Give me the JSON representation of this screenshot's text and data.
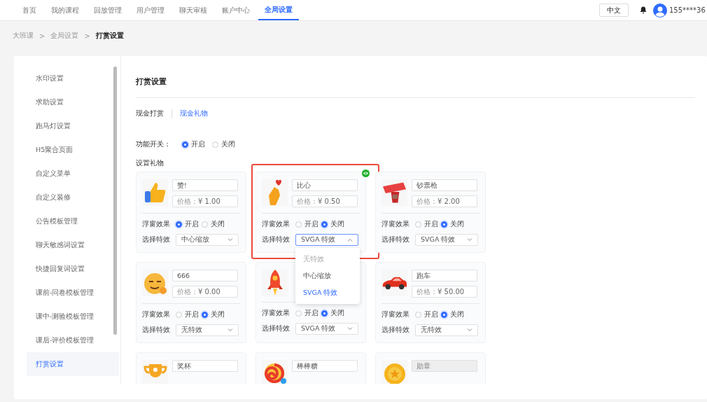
{
  "nav": {
    "tabs": [
      {
        "label": "首页",
        "selected": false
      },
      {
        "label": "我的课程",
        "selected": false
      },
      {
        "label": "回放管理",
        "selected": false
      },
      {
        "label": "用户管理",
        "selected": false
      },
      {
        "label": "聊天审核",
        "selected": false
      },
      {
        "label": "账户中心",
        "selected": false
      },
      {
        "label": "全局设置",
        "selected": true
      }
    ],
    "language": "中文",
    "user": "155****36"
  },
  "breadcrumb": [
    "大班课",
    "全局设置",
    "打赏设置"
  ],
  "breadcrumb_separator": ">",
  "sidebar": {
    "items": [
      {
        "label": "水印设置",
        "selected": false
      },
      {
        "label": "求助设置",
        "selected": false
      },
      {
        "label": "跑马灯设置",
        "selected": false
      },
      {
        "label": "H5聚合页面",
        "selected": false
      },
      {
        "label": "自定义菜单",
        "selected": false
      },
      {
        "label": "自定义装修",
        "selected": false
      },
      {
        "label": "公告模板管理",
        "selected": false
      },
      {
        "label": "聊天敏感词设置",
        "selected": false
      },
      {
        "label": "快捷回复词设置",
        "selected": false
      },
      {
        "label": "课前-问卷模板管理",
        "selected": false
      },
      {
        "label": "课中-测验模板管理",
        "selected": false
      },
      {
        "label": "课后-评价模板管理",
        "selected": false
      },
      {
        "label": "打赏设置",
        "selected": true
      }
    ]
  },
  "content": {
    "title": "打赏设置",
    "subtabs": [
      {
        "label": "现金打赏",
        "selected": false
      },
      {
        "label": "现金礼物",
        "selected": true
      }
    ],
    "switch": {
      "label": "功能开关：",
      "options": [
        {
          "label": "开启",
          "selected": true
        },
        {
          "label": "关闭",
          "selected": false
        }
      ]
    },
    "gifts_label": "设置礼物",
    "gifts": [
      {
        "kind": "thumb",
        "name": "赞!",
        "price_label": "价格：",
        "price": "¥ 1.00",
        "float_label": "浮窗效果",
        "float": [
          {
            "label": "开启",
            "selected": true
          },
          {
            "label": "关闭",
            "selected": false
          }
        ],
        "effect_label": "选择特效",
        "effect": "中心缩放"
      },
      {
        "kind": "heart",
        "name": "比心",
        "price_label": "价格：",
        "price": "¥ 0.50",
        "float_label": "浮窗效果",
        "float": [
          {
            "label": "开启",
            "selected": false
          },
          {
            "label": "关闭",
            "selected": true
          }
        ],
        "effect_label": "选择特效",
        "effect": "SVGA 特效",
        "highlighted": true,
        "dropdown": [
          {
            "label": "无特效",
            "selected": false
          },
          {
            "label": "中心缩放",
            "selected": false
          },
          {
            "label": "SVGA 特效",
            "selected": true
          }
        ]
      },
      {
        "kind": "banner",
        "name": "钞票枪",
        "price_label": "价格：",
        "price": "¥ 2.00",
        "float_label": "浮窗效果",
        "float": [
          {
            "label": "开启",
            "selected": false
          },
          {
            "label": "关闭",
            "selected": true
          }
        ],
        "effect_label": "选择特效",
        "effect": "SVGA 特效"
      },
      {
        "kind": "face",
        "name": "666",
        "price_label": "价格：",
        "price": "¥ 0.00",
        "float_label": "浮窗效果",
        "float": [
          {
            "label": "开启",
            "selected": false
          },
          {
            "label": "关闭",
            "selected": true
          }
        ],
        "effect_label": "选择特效",
        "effect": "无特效"
      },
      {
        "kind": "rocket",
        "float_label": "浮窗效果",
        "float": [
          {
            "label": "开启",
            "selected": false
          },
          {
            "label": "关闭",
            "selected": true
          }
        ],
        "effect_label": "选择特效",
        "effect": "SVGA 特效"
      },
      {
        "kind": "car",
        "name": "跑车",
        "price_label": "价格：",
        "price": "¥ 50.00",
        "float_label": "浮窗效果",
        "float": [
          {
            "label": "开启",
            "selected": false
          },
          {
            "label": "关闭",
            "selected": true
          }
        ],
        "effect_label": "选择特效",
        "effect": "无特效"
      },
      {
        "kind": "trophy",
        "name": "奖杯"
      },
      {
        "kind": "lollipop",
        "name": "棒棒糖"
      },
      {
        "kind": "medal",
        "name": "勋章",
        "disabled": true
      }
    ]
  }
}
